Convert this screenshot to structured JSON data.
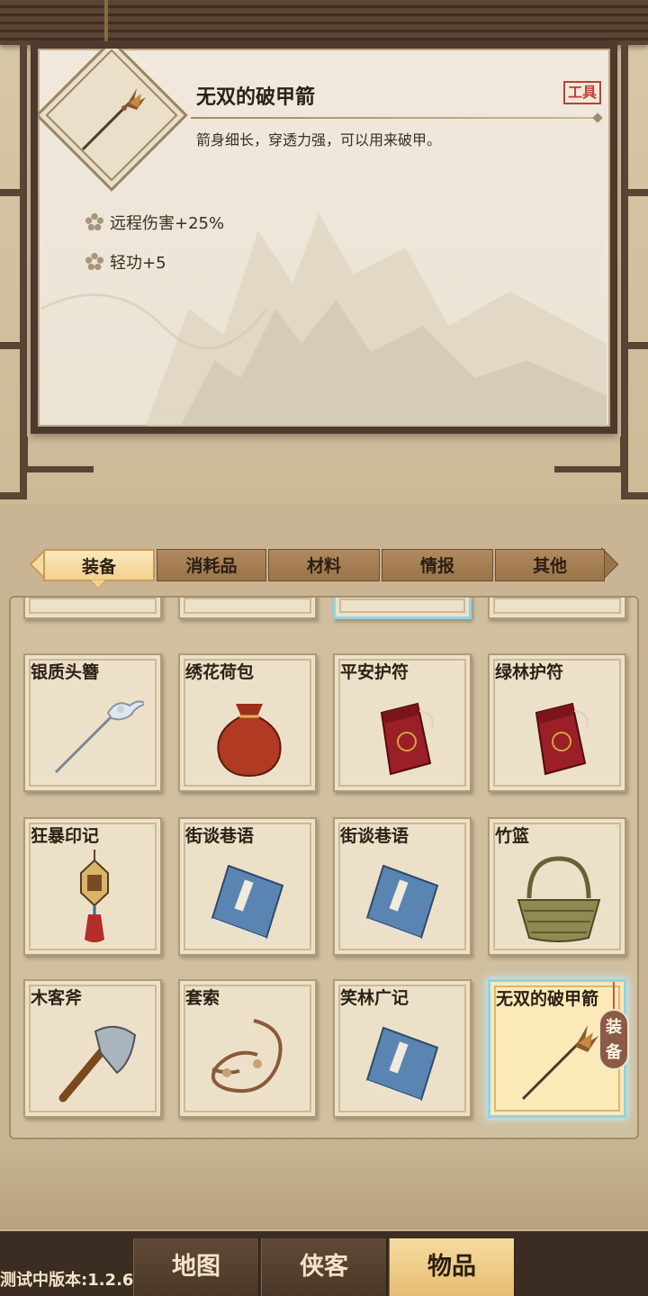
{
  "detail": {
    "name": "无双的破甲箭",
    "tag": "工具",
    "description": "箭身细长，穿透力强，可以用来破甲。",
    "stats": [
      "远程伤害+25%",
      "轻功+5"
    ]
  },
  "tabs": [
    {
      "label": "装备",
      "active": true
    },
    {
      "label": "消耗品",
      "active": false
    },
    {
      "label": "材料",
      "active": false
    },
    {
      "label": "情报",
      "active": false
    },
    {
      "label": "其他",
      "active": false
    }
  ],
  "items": [
    {
      "name": "银质头簪",
      "icon": "hairpin-icon"
    },
    {
      "name": "绣花荷包",
      "icon": "pouch-icon"
    },
    {
      "name": "平安护符",
      "icon": "amulet-bag-icon"
    },
    {
      "name": "绿林护符",
      "icon": "amulet-bag-icon"
    },
    {
      "name": "狂暴印记",
      "icon": "pendant-icon"
    },
    {
      "name": "街谈巷语",
      "icon": "book-icon"
    },
    {
      "name": "街谈巷语",
      "icon": "book-icon"
    },
    {
      "name": "竹篮",
      "icon": "basket-icon"
    },
    {
      "name": "木客斧",
      "icon": "axe-icon"
    },
    {
      "name": "套索",
      "icon": "rope-icon"
    },
    {
      "name": "笑林广记",
      "icon": "book-icon"
    },
    {
      "name": "无双的破甲箭",
      "icon": "arrow-icon",
      "selected": true,
      "badge": "装备"
    }
  ],
  "nav": [
    {
      "label": "地图",
      "active": false
    },
    {
      "label": "侠客",
      "active": false
    },
    {
      "label": "物品",
      "active": true
    }
  ],
  "version": "测试中版本:1.2.6",
  "colors": {
    "accent": "#f2d18e",
    "frame": "#4d3a2c",
    "tag_red": "#c13e32",
    "selected_glow": "#8fd4e6"
  }
}
